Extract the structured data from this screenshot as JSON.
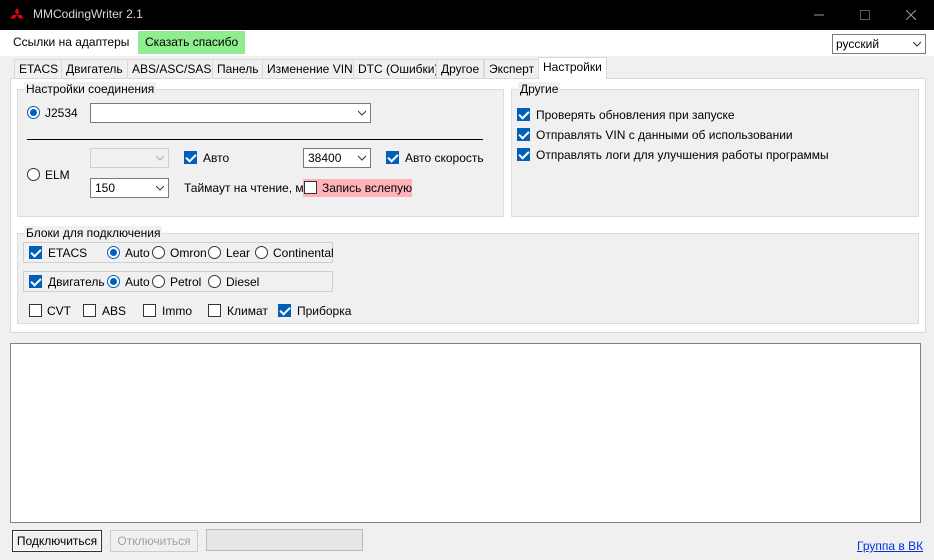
{
  "window": {
    "title": "MMCodingWriter 2.1",
    "minimize_icon": "minimize-icon",
    "maximize_icon": "maximize-icon",
    "close_icon": "close-icon"
  },
  "menu": {
    "adapters_link": "Ссылки на адаптеры",
    "thanks_button": "Сказать спасибо",
    "thanks_color": "#8fec8f"
  },
  "language": {
    "selected": "русский"
  },
  "tabs": [
    {
      "label": "ETACS"
    },
    {
      "label": "Двигатель"
    },
    {
      "label": "ABS/ASC/SAS"
    },
    {
      "label": "Панель"
    },
    {
      "label": "Изменение VIN"
    },
    {
      "label": "DTC (Ошибки)"
    },
    {
      "label": "Другое"
    },
    {
      "label": "Эксперт"
    },
    {
      "label": "Настройки"
    }
  ],
  "active_tab": "Настройки",
  "connection": {
    "legend": "Настройки соединения",
    "j2534_label": "J2534",
    "j2534_selected": true,
    "j2534_device": "",
    "elm_label": "ELM",
    "elm_selected": false,
    "elm_port": "",
    "auto_label": "Авто",
    "auto_checked": true,
    "baud": "38400",
    "auto_speed_label": "Авто скорость",
    "auto_speed_checked": true,
    "timeout_value": "150",
    "timeout_label": "Таймаут на чтение, мс",
    "blind_write_label": "Запись вслепую",
    "blind_write_checked": false,
    "blind_write_color": "#ffb3b8"
  },
  "other": {
    "legend": "Другие",
    "options": [
      {
        "label": "Проверять обновления при запуске",
        "checked": true
      },
      {
        "label": "Отправлять VIN с данными об использовании",
        "checked": true
      },
      {
        "label": "Отправлять логи для улучшения работы программы",
        "checked": true
      }
    ]
  },
  "blocks": {
    "legend": "Блоки для подключения",
    "etacs": {
      "label": "ETACS",
      "checked": true,
      "options": [
        "Auto",
        "Omron",
        "Lear",
        "Continental"
      ],
      "selected": "Auto"
    },
    "engine": {
      "label": "Двигатель",
      "checked": true,
      "options": [
        "Auto",
        "Petrol",
        "Diesel"
      ],
      "selected": "Auto"
    },
    "extra": [
      {
        "label": "CVT",
        "checked": false
      },
      {
        "label": "ABS",
        "checked": false
      },
      {
        "label": "Immo",
        "checked": false
      },
      {
        "label": "Климат",
        "checked": false
      },
      {
        "label": "Приборка",
        "checked": true
      }
    ]
  },
  "log": {
    "text": ""
  },
  "footer": {
    "connect_button": "Подключиться",
    "disconnect_button": "Отключиться",
    "progress": 0,
    "vk_link": "Группа в ВК"
  },
  "colors": {
    "accent": "#005fb8",
    "titlebar": "#000000"
  }
}
